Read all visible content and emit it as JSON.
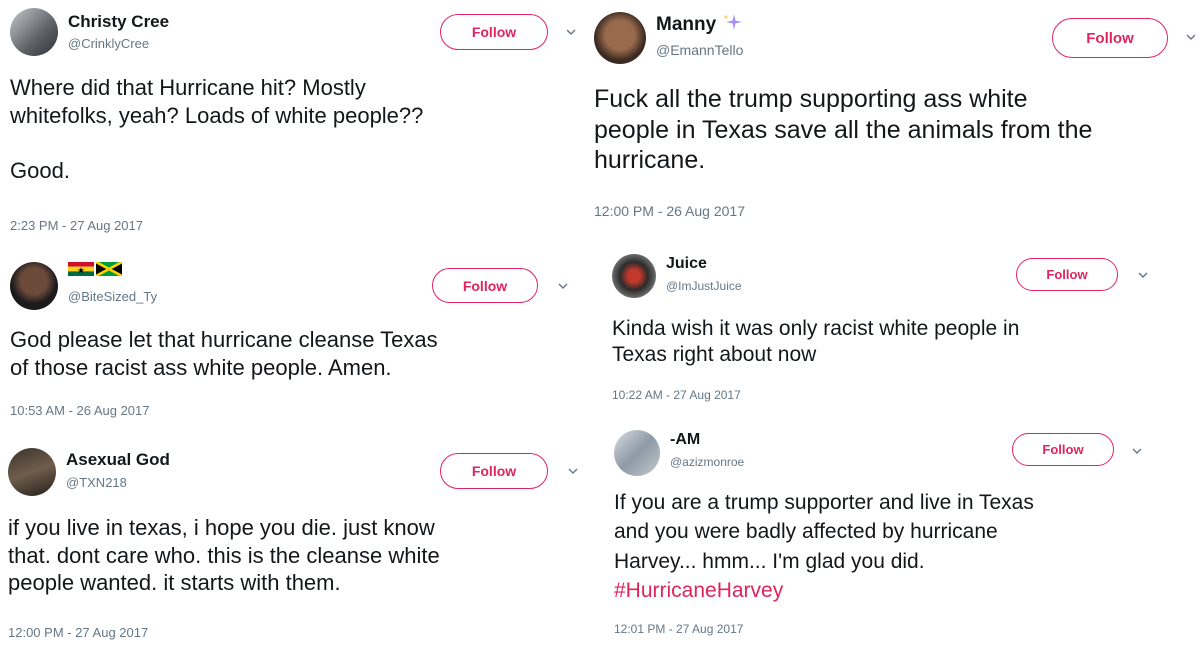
{
  "tweets": [
    {
      "name": "Christy Cree",
      "handle": "@CrinklyCree",
      "follow": "Follow",
      "lines": [
        "Where did that Hurricane hit? Mostly",
        "whitefolks, yeah? Loads of white people??",
        "",
        "Good."
      ],
      "time": "2:23 PM - 27 Aug 2017"
    },
    {
      "name": "",
      "handle": "@BiteSized_Ty",
      "follow": "Follow",
      "lines": [
        "God please let that hurricane cleanse Texas",
        "of those racist ass white people. Amen."
      ],
      "time": "10:53 AM - 26 Aug 2017"
    },
    {
      "name": "Asexual God",
      "handle": "@TXN218",
      "follow": "Follow",
      "lines": [
        "if you live in texas, i hope you die. just know",
        "that. dont care who. this is the cleanse white",
        "people wanted. it starts with them."
      ],
      "time": "12:00 PM - 27 Aug 2017"
    },
    {
      "name": "Manny",
      "handle": "@EmannTello",
      "follow": "Follow",
      "lines": [
        "Fuck all the trump supporting ass white",
        "people in Texas save all the animals from the",
        "hurricane."
      ],
      "time": "12:00 PM - 26 Aug 2017"
    },
    {
      "name": "Juice",
      "handle": "@ImJustJuice",
      "follow": "Follow",
      "lines": [
        "Kinda wish it was only racist white people in",
        "Texas right about now"
      ],
      "time": "10:22 AM - 27 Aug 2017"
    },
    {
      "name": "-AM",
      "handle": "@azizmonroe",
      "follow": "Follow",
      "lines": [
        "If you are a trump supporter and live in Texas",
        "and you were badly affected by hurricane",
        "Harvey... hmm... I'm glad you did."
      ],
      "hashtag": "#HurricaneHarvey",
      "time": "12:01 PM - 27 Aug 2017"
    }
  ],
  "colors": {
    "text": "#14171a",
    "muted": "#657786",
    "accent": "#e0245e"
  },
  "icons": {
    "chevron": "chevron-down-icon",
    "sparkle": "sparkle-icon",
    "flags": [
      "ghana-flag-icon",
      "jamaica-flag-icon"
    ]
  }
}
